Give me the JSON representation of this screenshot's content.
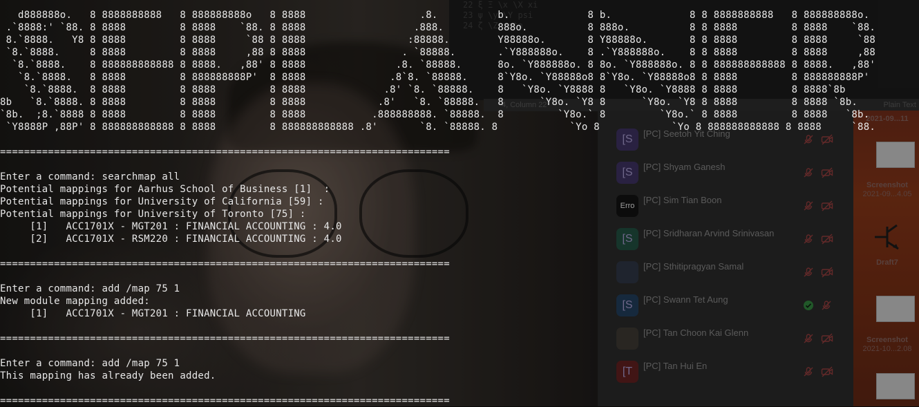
{
  "colors": {
    "terminal_text": "#e8e8e8",
    "panel_bg": "#272727",
    "desktop_bg": "#6e2b13"
  },
  "editor_background": {
    "lines": [
      "22    ξ   Ξ   \\x   \\X   xi",
      "23    ψ   \\y   \\Y   psi",
      "24    ζ   \\Z   zeta"
    ],
    "status_left": "4, Column 22",
    "status_right": "Plain Text"
  },
  "ascii_banner": [
    "   d888888o.   8 8888888888   8 888888888o   8 8888                   .8.          b.             8 b.             8 8 8888888888   8 888888888o.",
    " .`8888:' `88. 8 8888         8 8888    `88. 8 8888                  .888.         888o.          8 888o.          8 8 8888         8 8888    `88.",
    " 8.`8888.   Y8 8 8888         8 8888     `88 8 8888                 :88888.        Y88888o.       8 Y88888o.       8 8 8888         8 8888     `88",
    " `8.`8888.     8 8888         8 8888     ,88 8 8888                . `88888.       .`Y888888o.    8 .`Y888888o.    8 8 8888         8 8888     ,88",
    "  `8.`8888.    8 888888888888 8 8888.   ,88' 8 8888               .8. `88888.      8o. `Y888888o. 8 8o. `Y888888o. 8 8 888888888888 8 8888.   ,88'",
    "   `8.`8888.   8 8888         8 888888888P'  8 8888              .8`8. `88888.     8`Y8o. `Y88888o8 8`Y8o. `Y88888o8 8 8888         8 888888888P'",
    "    `8.`8888.  8 8888         8 8888         8 8888             .8' `8. `88888.    8   `Y8o. `Y8888 8   `Y8o. `Y8888 8 8888         8 8888`8b",
    "8b   `8.`8888. 8 8888         8 8888         8 8888            .8'   `8. `88888.   8      `Y8o. `Y8 8      `Y8o. `Y8 8 8888         8 8888 `8b.",
    "`8b.  ;8.`8888 8 8888         8 8888         8 8888           .888888888. `88888.  8         `Y8o.` 8         `Y8o.` 8 8888         8 8888   `8b.",
    " `Y8888P ,88P' 8 888888888888 8 8888         8 888888888888 .8'       `8. `88888. 8            `Yo 8            `Yo 8 888888888888 8 8888     `88."
  ],
  "separator": "===========================================================================",
  "terminal_lines": [
    "Enter a command: searchmap all",
    "Potential mappings for Aarhus School of Business [1]  :",
    "Potential mappings for University of California [59] :",
    "Potential mappings for University of Toronto [75] :",
    "     [1]   ACC1701X - MGT201 : FINANCIAL ACCOUNTING : 4.0",
    "     [2]   ACC1701X - RSM220 : FINANCIAL ACCOUNTING : 4.0",
    "Enter a command: add /map 75 1",
    "New module mapping added:",
    "     [1]   ACC1701X - MGT201 : FINANCIAL ACCOUNTING",
    "Enter a command: add /map 75 1",
    "This mapping has already been added."
  ],
  "participants": [
    {
      "name": "[PC] Seetoh Yit Ching",
      "avatar": "[S",
      "avatar_color": "#3a2f5a"
    },
    {
      "name": "[PC] Shyam Ganesh",
      "avatar": "[S",
      "avatar_color": "#3a2f5a"
    },
    {
      "name": "[PC] Sim Tian Boon",
      "avatar": "Erro",
      "avatar_color": "#111111"
    },
    {
      "name": "[PC] Sridharan Arvind Srinivasan",
      "avatar": "[S",
      "avatar_color": "#1f4a3c"
    },
    {
      "name": "[PC] Sthitipragyan Samal",
      "avatar": "",
      "avatar_color": "#2c3340"
    },
    {
      "name": "[PC] Swann Tet Aung",
      "avatar": "[S",
      "avatar_color": "#1f3a55"
    },
    {
      "name": "[PC] Tan Choon Kai Glenn",
      "avatar": "",
      "avatar_color": "#3a3530"
    },
    {
      "name": "[PC] Tan Hui En",
      "avatar": "[T",
      "avatar_color": "#5a1e1e"
    }
  ],
  "desktop_items": [
    {
      "label": "Screenshot",
      "sub": "2021-09...4.05"
    },
    {
      "label": "Draft7",
      "sub": ""
    },
    {
      "label": "Screenshot",
      "sub": "2021-10...2.08"
    }
  ],
  "desktop_top_label": "2021-09...11"
}
